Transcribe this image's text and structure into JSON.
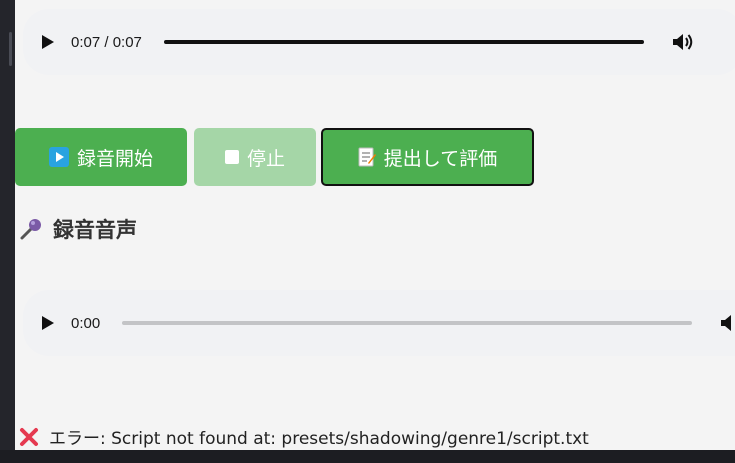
{
  "player_top": {
    "time": "0:07 / 0:07",
    "progress": 1.0,
    "play_icon": "play-icon",
    "volume_icon": "volume-icon"
  },
  "controls": {
    "start_label": "録音開始",
    "stop_label": "停止",
    "submit_label": "提出して評価",
    "accent_color": "#4caf50",
    "disabled_color": "#a5d6a7"
  },
  "recording": {
    "heading": "録音音声",
    "time": "0:00",
    "progress": 0.0
  },
  "status": {
    "error_text": "エラー: Script not found at: presets/shadowing/genre1/script.txt",
    "error_color": "#e53950"
  }
}
